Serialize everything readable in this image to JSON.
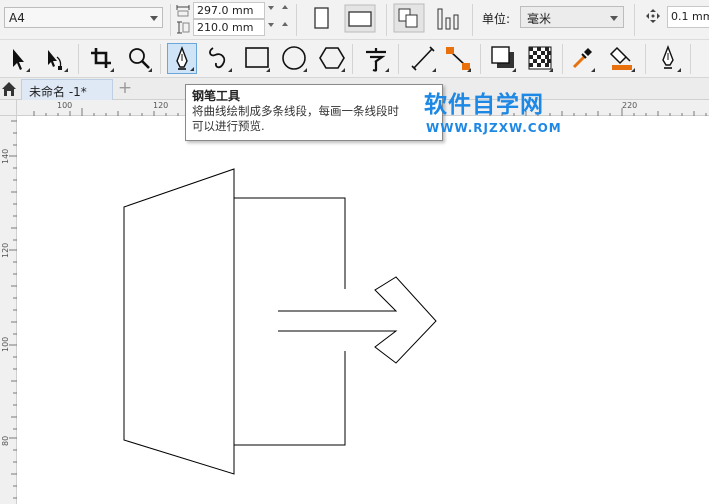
{
  "property_bar": {
    "page_size": "A4",
    "width_value": "297.0 mm",
    "height_value": "210.0 mm",
    "units_label": "单位:",
    "units_value": "毫米",
    "nudge_value": "0.1 mm",
    "buttons": [
      "portrait-icon",
      "landscape-icon",
      "all-pages-icon",
      "current-page-icon"
    ]
  },
  "toolbox": {
    "tools": [
      "pick-tool-icon",
      "shape-tool-icon",
      "crop-tool-icon",
      "zoom-tool-icon",
      "pen-tool-icon",
      "freehand-tool-icon",
      "rectangle-tool-icon",
      "ellipse-tool-icon",
      "polygon-tool-icon",
      "text-tool-icon",
      "dimension-tool-icon",
      "connector-tool-icon",
      "drop-shadow-tool-icon",
      "transparency-tool-icon",
      "eyedropper-tool-icon",
      "interactive-fill-tool-icon",
      "smart-fill-tool-icon"
    ],
    "active_tool": "pen-tool-icon"
  },
  "document": {
    "tab_label": "未命名 -1*",
    "add_tab_label": "+"
  },
  "rulers": {
    "horizontal_labels": [
      "100",
      "120",
      "220"
    ],
    "vertical_labels": [
      "140",
      "120",
      "100",
      "80"
    ]
  },
  "tooltip": {
    "title": "钢笔工具",
    "line1": "将曲线绘制成多条线段，每画一条线段时",
    "line2": "可以进行预览."
  },
  "watermark": {
    "title": "软件自学网",
    "url": "WWW.RJZXW.COM",
    "color": "#1e88e5"
  }
}
